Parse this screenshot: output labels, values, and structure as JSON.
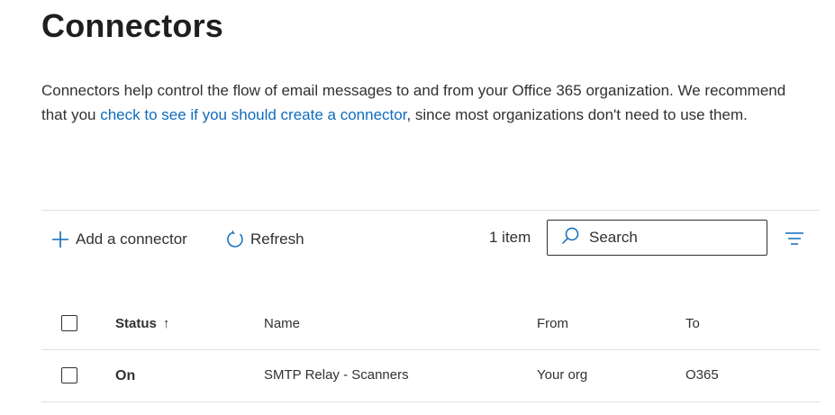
{
  "page": {
    "title": "Connectors",
    "description_part1": "Connectors help control the flow of email messages to and from your Office 365 organization. We recommend that you ",
    "description_link": "check to see if you should create a connector",
    "description_part2": ", since most organizations don't need to use them."
  },
  "toolbar": {
    "add_label": "Add a connector",
    "add_icon": "plus-icon",
    "refresh_label": "Refresh",
    "refresh_icon": "refresh-icon",
    "item_count": "1 item",
    "search_placeholder": "Search",
    "search_icon": "search-icon",
    "filter_icon": "filter-icon"
  },
  "table": {
    "columns": {
      "status": "Status",
      "status_sort": "↑",
      "name": "Name",
      "from": "From",
      "to": "To"
    },
    "rows": [
      {
        "status": "On",
        "name": "SMTP Relay - Scanners",
        "from": "Your org",
        "to": "O365"
      }
    ]
  },
  "colors": {
    "link": "#0f6cbd",
    "accent_icon": "#0f6cbd",
    "text": "#323130",
    "divider": "#e1dfdd"
  }
}
